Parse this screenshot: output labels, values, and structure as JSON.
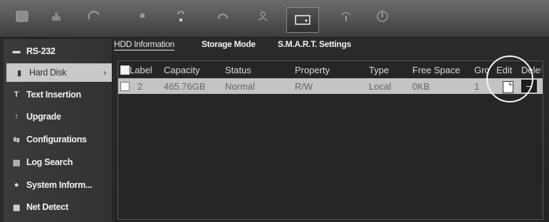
{
  "toolbar": {
    "icons": [
      "display-icon",
      "camera-icon",
      "gauge-icon",
      "record-icon",
      "alarm-icon",
      "network-icon",
      "user-icon",
      "storage-icon",
      "info-icon",
      "shutdown-icon"
    ]
  },
  "sidebar": {
    "items": [
      {
        "label": "RS-232",
        "icon": "port-icon"
      },
      {
        "label": "Hard Disk",
        "icon": "disk-icon",
        "selected": true
      },
      {
        "label": "Text Insertion",
        "icon": "text-icon"
      },
      {
        "label": "Upgrade",
        "icon": "upgrade-icon"
      },
      {
        "label": "Configurations",
        "icon": "config-icon"
      },
      {
        "label": "Log Search",
        "icon": "log-icon"
      },
      {
        "label": "System Inform...",
        "icon": "system-icon"
      },
      {
        "label": "Net Detect",
        "icon": "net-icon"
      }
    ]
  },
  "tabs": [
    {
      "label": "HDD Information",
      "active": true
    },
    {
      "label": "Storage Mode"
    },
    {
      "label": "S.M.A.R.T. Settings"
    }
  ],
  "table": {
    "headers": {
      "label": "Label",
      "capacity": "Capacity",
      "status": "Status",
      "property": "Property",
      "type": "Type",
      "free_space": "Free Space",
      "group": "Group",
      "edit": "Edit",
      "delete": "Delete"
    },
    "rows": [
      {
        "label": "2",
        "capacity": "465.76GB",
        "status": "Normal",
        "property": "R/W",
        "type": "Local",
        "free_space": "0KB",
        "group": "1"
      }
    ]
  }
}
